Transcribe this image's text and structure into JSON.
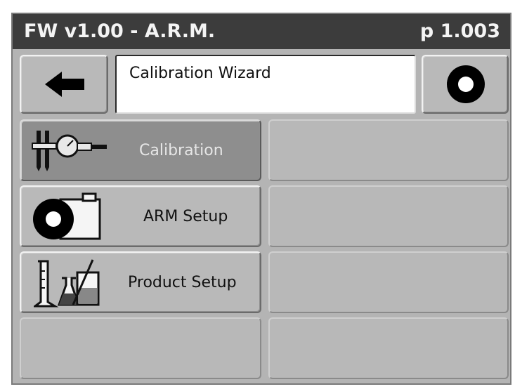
{
  "titlebar": {
    "title": "FW v1.00 - A.R.M.",
    "page": "p 1.003"
  },
  "header": {
    "back_icon": "left-arrow-icon",
    "wizard_title": "Calibration Wizard",
    "record_icon": "ring-icon"
  },
  "menu": {
    "items": [
      {
        "label": "Calibration",
        "icon": "caliper-gauge-icon",
        "selected": true
      },
      {
        "label": "ARM Setup",
        "icon": "tank-icon",
        "selected": false
      },
      {
        "label": "Product Setup",
        "icon": "lab-glassware-icon",
        "selected": false
      }
    ]
  },
  "colors": {
    "titlebar_bg": "#3c3c3c",
    "screen_bg": "#b4b4b4",
    "selected_bg": "#8e8e8e"
  }
}
